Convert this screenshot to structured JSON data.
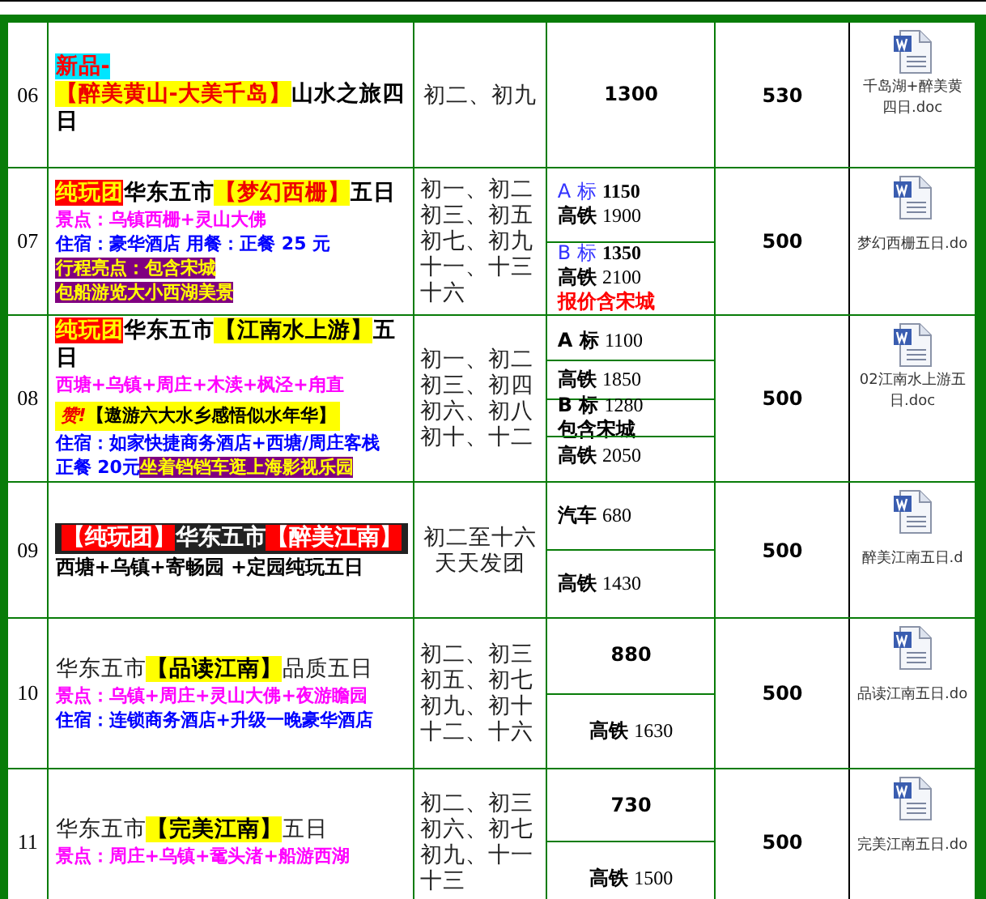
{
  "rows": [
    {
      "number": "06",
      "lines": [
        {
          "kind": "title",
          "segments": [
            {
              "kind": "new",
              "text": "新品-"
            }
          ]
        },
        {
          "kind": "title",
          "segments": [
            {
              "kind": "mark",
              "text": "【醉美黄山-大美千岛】"
            },
            {
              "kind": "plain",
              "text": "山水之旅四日"
            }
          ]
        }
      ],
      "dates": [
        "初二、初九"
      ],
      "prices": [
        {
          "lines": [
            {
              "kind": "amount",
              "value": "1300"
            }
          ]
        }
      ],
      "deposit": "530",
      "file": [
        "千岛湖+醉美黄",
        "四日.doc"
      ]
    },
    {
      "number": "07",
      "lines": [
        {
          "kind": "title",
          "segments": [
            {
              "kind": "tag",
              "text": "纯玩团"
            },
            {
              "kind": "plain",
              "text": "华东五市"
            },
            {
              "kind": "mark",
              "text": "【梦幻西栅】"
            },
            {
              "kind": "plain",
              "text": "五日"
            }
          ]
        },
        {
          "kind": "sights",
          "segments": [
            {
              "kind": "sights",
              "text": "景点：乌镇西栅+灵山大佛"
            }
          ]
        },
        {
          "kind": "lodging",
          "segments": [
            {
              "kind": "lodging",
              "text": "住宿：豪华酒店 用餐：正餐 25 元"
            }
          ]
        },
        {
          "kind": "highlight",
          "segments": [
            {
              "kind": "boxed",
              "text": "行程亮点：包含宋城"
            }
          ]
        },
        {
          "kind": "highlight",
          "segments": [
            {
              "kind": "boxed",
              "text": "包船游览大小西湖美景"
            }
          ]
        }
      ],
      "dates": [
        "初一、初二",
        "初三、初五",
        "初七、初九",
        "十一、十三",
        "十六"
      ],
      "prices": [
        {
          "lines": [
            {
              "kind": "grade",
              "label": "A 标",
              "value": "1150"
            },
            {
              "kind": "rail",
              "label": "高铁",
              "value": "1900"
            }
          ]
        },
        {
          "lines": [
            {
              "kind": "grade",
              "label": "B 标",
              "value": "1350"
            },
            {
              "kind": "rail",
              "label": "高铁",
              "value": "2100"
            },
            {
              "kind": "warning",
              "label": "报价含宋城"
            }
          ]
        }
      ],
      "deposit": "500",
      "file": [
        "梦幻西栅五日.do"
      ]
    },
    {
      "number": "08",
      "lines": [
        {
          "kind": "title",
          "segments": [
            {
              "kind": "tag",
              "text": "纯玩团"
            },
            {
              "kind": "plain",
              "text": "华东五市"
            },
            {
              "kind": "mark-dark",
              "text": "【江南水上游】"
            },
            {
              "kind": "plain",
              "text": "五日"
            }
          ]
        },
        {
          "kind": "sights",
          "segments": [
            {
              "kind": "sights",
              "text": "西塘+乌镇+周庄+木渎+枫泾+甪直"
            }
          ]
        },
        {
          "kind": "banner",
          "segments": [
            {
              "kind": "burst",
              "text": "赞!"
            },
            {
              "kind": "banner",
              "text": "【遨游六大水乡感悟似水年华】"
            }
          ]
        },
        {
          "kind": "lodging",
          "segments": [
            {
              "kind": "lodging",
              "text": "住宿：如家快捷商务酒店+西塘/周庄客栈"
            }
          ]
        },
        {
          "kind": "lodging",
          "segments": [
            {
              "kind": "lodging",
              "text": "正餐 20元"
            },
            {
              "kind": "boxed",
              "text": "坐着铛铛车逛上海影视乐园"
            }
          ]
        }
      ],
      "dates": [
        "初一、初二",
        "初三、初四",
        "初六、初八",
        "初十、十二"
      ],
      "prices": [
        {
          "lines": [
            {
              "kind": "grade-dark",
              "label": "A 标",
              "value": "1100"
            }
          ]
        },
        {
          "lines": [
            {
              "kind": "rail",
              "label": "高铁",
              "value": "1850"
            }
          ]
        },
        {
          "lines": [
            {
              "kind": "grade-dark",
              "label": "B 标",
              "value": "1280"
            },
            {
              "kind": "label",
              "label": "包含宋城"
            }
          ]
        },
        {
          "lines": [
            {
              "kind": "rail",
              "label": "高铁",
              "value": "2050"
            }
          ]
        }
      ],
      "deposit": "500",
      "file": [
        "02江南水上游五",
        "日.doc"
      ]
    },
    {
      "number": "09",
      "lines": [
        {
          "kind": "inverse",
          "segments": [
            {
              "kind": "inverse-red",
              "text": "【纯玩团】"
            },
            {
              "kind": "inverse-dark",
              "text": "华东五市"
            },
            {
              "kind": "inverse-red",
              "text": "【醉美江南】"
            }
          ]
        },
        {
          "kind": "note",
          "segments": [
            {
              "kind": "note",
              "text": "西塘+乌镇+寄畅园 +定园纯玩五日"
            }
          ]
        }
      ],
      "dates": [
        "初二至十六",
        "天天发团"
      ],
      "prices": [
        {
          "lines": [
            {
              "kind": "rail",
              "label": "汽车",
              "value": "680"
            }
          ]
        },
        {
          "lines": [
            {
              "kind": "rail",
              "label": "高铁",
              "value": "1430"
            }
          ]
        }
      ],
      "deposit": "500",
      "file": [
        "醉美江南五日.d"
      ]
    },
    {
      "number": "10",
      "lines": [
        {
          "kind": "title",
          "segments": [
            {
              "kind": "light",
              "text": "华东五市"
            },
            {
              "kind": "mark-dark",
              "text": "【品读江南】"
            },
            {
              "kind": "light",
              "text": "品质五日"
            }
          ]
        },
        {
          "kind": "sights",
          "segments": [
            {
              "kind": "sights",
              "text": "景点：乌镇+周庄+灵山大佛+夜游瞻园"
            }
          ]
        },
        {
          "kind": "lodging",
          "segments": [
            {
              "kind": "lodging",
              "text": "住宿：连锁商务酒店+升级一晚豪华酒店"
            }
          ]
        }
      ],
      "dates": [
        "初二、初三",
        "初五、初七",
        "初九、初十",
        "十二、十六"
      ],
      "prices": [
        {
          "lines": [
            {
              "kind": "amount",
              "value": "880"
            }
          ]
        },
        {
          "lines": [
            {
              "kind": "rail",
              "label": "高铁",
              "value": "1630"
            }
          ]
        }
      ],
      "deposit": "500",
      "file": [
        "品读江南五日.do"
      ]
    },
    {
      "number": "11",
      "lines": [
        {
          "kind": "title",
          "segments": [
            {
              "kind": "light",
              "text": "华东五市"
            },
            {
              "kind": "mark-dark",
              "text": "【完美江南】"
            },
            {
              "kind": "light",
              "text": "五日"
            }
          ]
        },
        {
          "kind": "sights",
          "segments": [
            {
              "kind": "sights",
              "text": "景点：周庄+乌镇+鼋头渚+船游西湖"
            }
          ]
        }
      ],
      "dates": [
        "初二、初三",
        "初六、初七",
        "初九、十一",
        "十三"
      ],
      "prices": [
        {
          "lines": [
            {
              "kind": "amount",
              "value": "730"
            }
          ]
        },
        {
          "lines": [
            {
              "kind": "rail",
              "label": "高铁",
              "value": "1500"
            }
          ]
        }
      ],
      "deposit": "500",
      "file": [
        "完美江南五日.do"
      ]
    }
  ]
}
